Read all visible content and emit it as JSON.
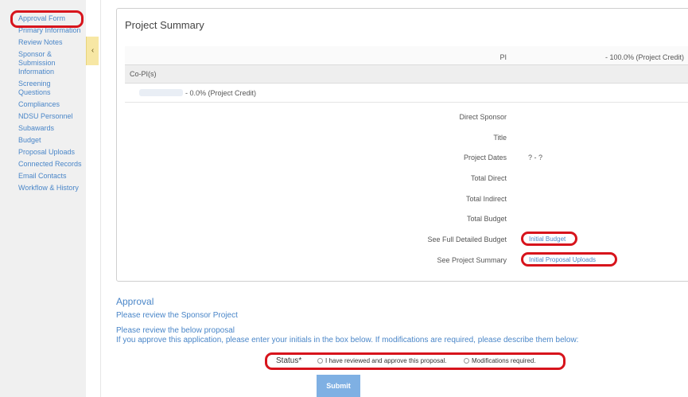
{
  "sidebar": {
    "items": [
      {
        "label": "Approval Form"
      },
      {
        "label": "Primary Information"
      },
      {
        "label": "Review Notes"
      },
      {
        "label": "Sponsor & Submission Information"
      },
      {
        "label": "Screening Questions"
      },
      {
        "label": "Compliances"
      },
      {
        "label": "NDSU Personnel"
      },
      {
        "label": "Subawards"
      },
      {
        "label": "Budget"
      },
      {
        "label": "Proposal Uploads"
      },
      {
        "label": "Connected Records"
      },
      {
        "label": "Email Contacts"
      },
      {
        "label": "Workflow & History"
      }
    ],
    "collapse_glyph": "‹"
  },
  "summary": {
    "title": "Project Summary",
    "pi_label": "PI",
    "pi_value": "- 100.0% (Project Credit)",
    "copi_header": "Co-PI(s)",
    "copi_value": "- 0.0% (Project Credit)",
    "fields": {
      "direct_sponsor_label": "Direct Sponsor",
      "title_label": "Title",
      "project_dates_label": "Project Dates",
      "project_dates_value": "? - ?",
      "total_direct_label": "Total Direct",
      "total_indirect_label": "Total Indirect",
      "total_budget_label": "Total Budget",
      "full_budget_label": "See Full Detailed Budget",
      "full_budget_link": "Initial Budget",
      "project_summary_label": "See Project Summary",
      "project_summary_link": "Initial Proposal Uploads"
    }
  },
  "approval": {
    "title": "Approval",
    "line1": "Please review the Sponsor Project",
    "line2": "Please review the below proposal",
    "line3": "If you approve this application, please enter your initials in the box below. If modifications are required, please describe them below:",
    "status_label": "Status*",
    "option_approve": "I have reviewed and approve this proposal.",
    "option_modify": "Modifications required.",
    "submit_label": "Submit"
  },
  "colors": {
    "link": "#4a86c8",
    "highlight": "#d7141c",
    "submit": "#7fb0e3",
    "collapse_tab": "#f7e7a4"
  }
}
